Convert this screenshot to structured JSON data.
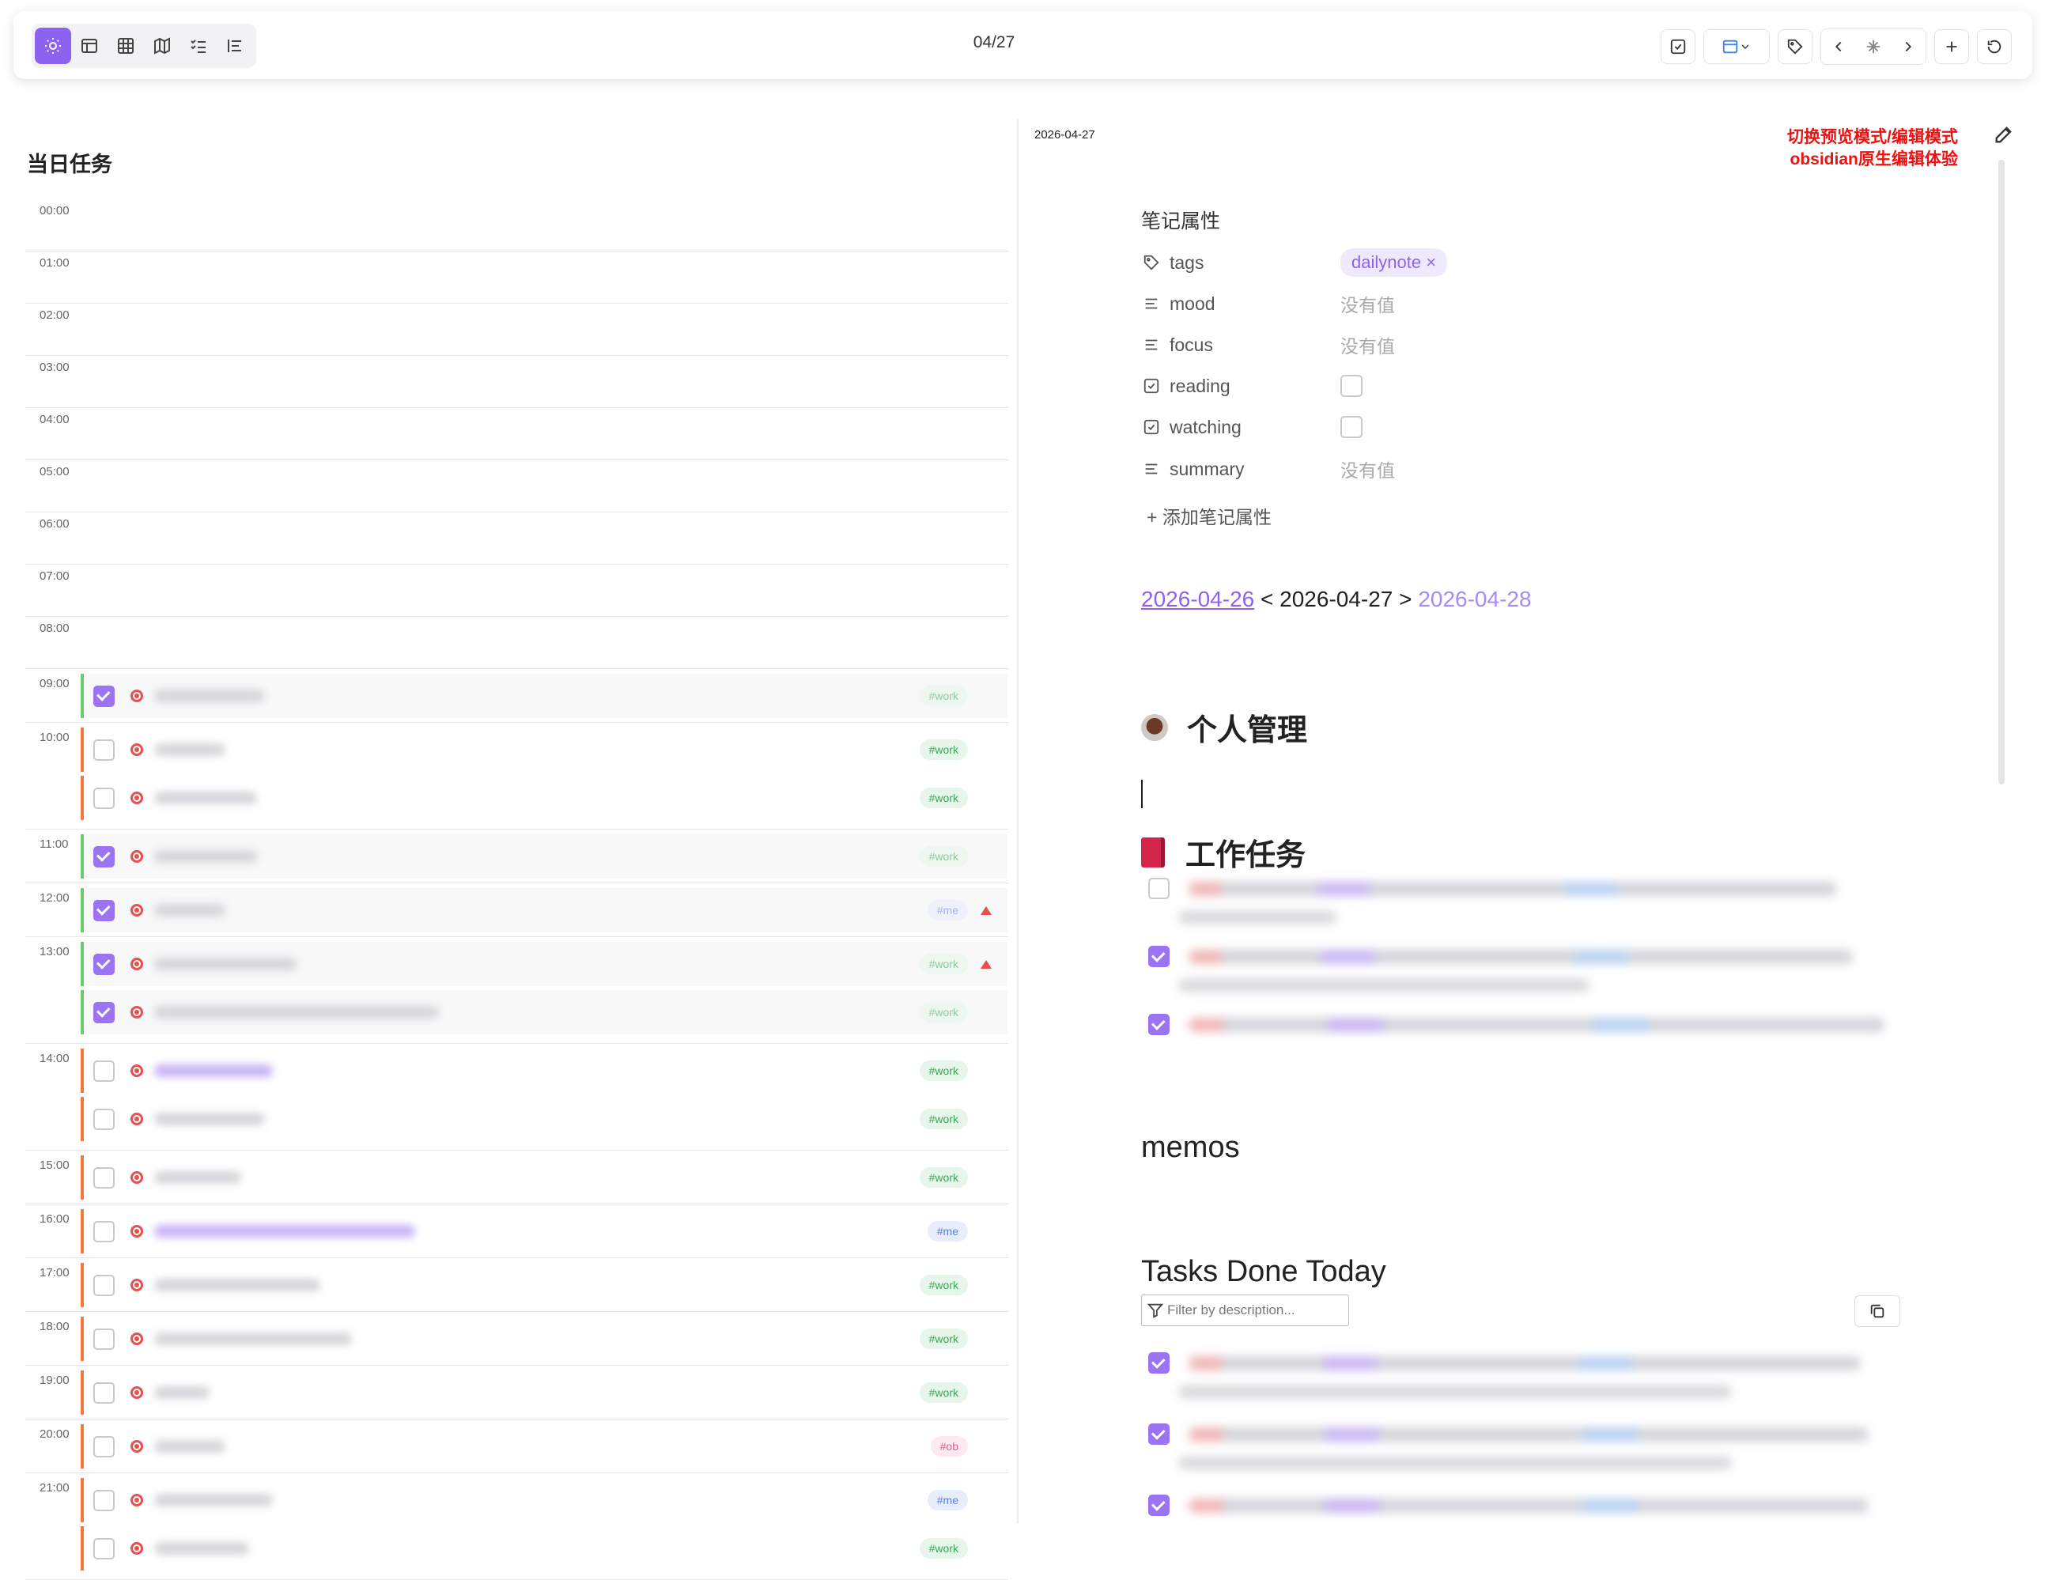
{
  "toolbar": {
    "date_label": "04/27",
    "left_buttons": [
      "sun-icon",
      "layout-icon",
      "grid-icon",
      "map-icon",
      "checklist-icon",
      "list-indent-icon"
    ],
    "right_buttons": [
      "checkbox-icon",
      "calendar-upload-icon",
      "tag-icon",
      "chevron-left-icon",
      "sparkle-icon",
      "chevron-right-icon",
      "plus-icon",
      "refresh-icon"
    ]
  },
  "left": {
    "title": "当日任务",
    "hours": [
      "00:00",
      "01:00",
      "02:00",
      "03:00",
      "04:00",
      "05:00",
      "06:00",
      "07:00",
      "08:00",
      "09:00",
      "10:00",
      "11:00",
      "12:00",
      "13:00",
      "14:00",
      "15:00",
      "16:00",
      "17:00",
      "18:00",
      "19:00",
      "20:00",
      "21:00"
    ],
    "tasks": [
      {
        "hour": "09:00",
        "done": true,
        "tag": "#work",
        "prio": false
      },
      {
        "hour": "10:00",
        "done": false,
        "tag": "#work",
        "prio": false
      },
      {
        "hour": "",
        "done": false,
        "tag": "#work",
        "prio": false
      },
      {
        "hour": "11:00",
        "done": true,
        "tag": "#work",
        "prio": false
      },
      {
        "hour": "12:00",
        "done": true,
        "tag": "#me",
        "prio": true
      },
      {
        "hour": "13:00",
        "done": true,
        "tag": "#work",
        "prio": true
      },
      {
        "hour": "",
        "done": true,
        "tag": "#work",
        "prio": false
      },
      {
        "hour": "14:00",
        "done": false,
        "tag": "#work",
        "prio": false
      },
      {
        "hour": "",
        "done": false,
        "tag": "#work",
        "prio": false
      },
      {
        "hour": "15:00",
        "done": false,
        "tag": "#work",
        "prio": false
      },
      {
        "hour": "16:00",
        "done": false,
        "tag": "#me",
        "prio": false
      },
      {
        "hour": "17:00",
        "done": false,
        "tag": "#work",
        "prio": false
      },
      {
        "hour": "18:00",
        "done": false,
        "tag": "#work",
        "prio": false
      },
      {
        "hour": "19:00",
        "done": false,
        "tag": "#work",
        "prio": false
      },
      {
        "hour": "20:00",
        "done": false,
        "tag": "#ob",
        "prio": false
      },
      {
        "hour": "21:00",
        "done": false,
        "tag": "#me",
        "prio": false
      },
      {
        "hour": "",
        "done": false,
        "tag": "#work",
        "prio": false
      }
    ]
  },
  "note": {
    "date": "2026-04-27",
    "annotation_line1": "切换预览模式/编辑模式",
    "annotation_line2": "obsidian原生编辑体验",
    "props_title": "笔记属性",
    "props": {
      "tags_key": "tags",
      "tags_value": "dailynote",
      "tags_remove": "×",
      "mood_key": "mood",
      "focus_key": "focus",
      "reading_key": "reading",
      "watching_key": "watching",
      "summary_key": "summary",
      "empty_value": "没有值"
    },
    "add_prop": "+ 添加笔记属性",
    "nav": {
      "prev": "2026-04-26",
      "sep1": " < ",
      "current": "2026-04-27",
      "sep2": " > ",
      "next": "2026-04-28"
    },
    "heading_personal": "个人管理",
    "heading_work": "工作任务",
    "work_tasks": [
      false,
      true,
      true
    ],
    "heading_memos": "memos",
    "heading_done": "Tasks Done Today",
    "filter_placeholder": "Filter by description...",
    "done_tasks": [
      true,
      true,
      true
    ]
  }
}
